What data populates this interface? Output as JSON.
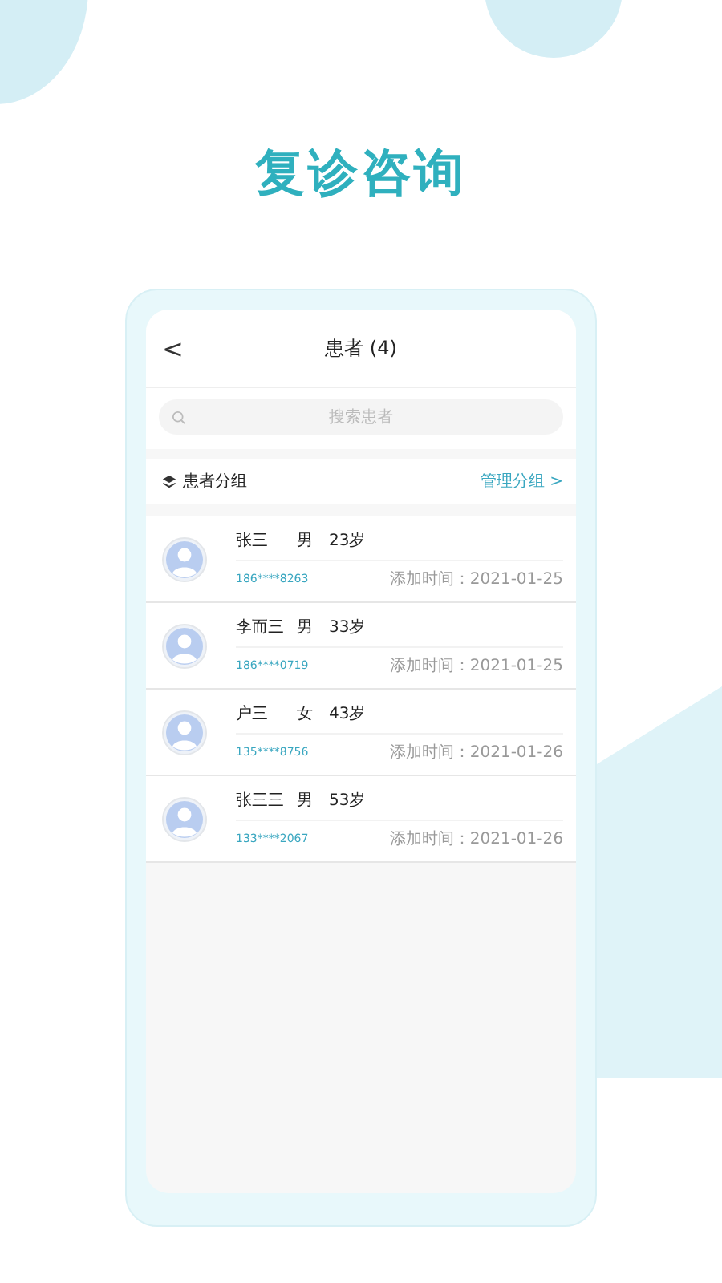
{
  "headline": "复诊咨询",
  "header": {
    "back": "<",
    "title": "患者 (4)"
  },
  "search": {
    "placeholder": "搜索患者"
  },
  "group_bar": {
    "label": "患者分组",
    "action": "管理分组 >"
  },
  "patients": [
    {
      "name": "张三",
      "gender": "男",
      "age": "23岁",
      "phone": "186****8263",
      "added": "添加时间：2021-01-25"
    },
    {
      "name": "李而三",
      "gender": "男",
      "age": "33岁",
      "phone": "186****0719",
      "added": "添加时间：2021-01-25"
    },
    {
      "name": "户三",
      "gender": "女",
      "age": "43岁",
      "phone": "135****8756",
      "added": "添加时间：2021-01-26"
    },
    {
      "name": "张三三",
      "gender": "男",
      "age": "53岁",
      "phone": "133****2067",
      "added": "添加时间：2021-01-26"
    }
  ]
}
